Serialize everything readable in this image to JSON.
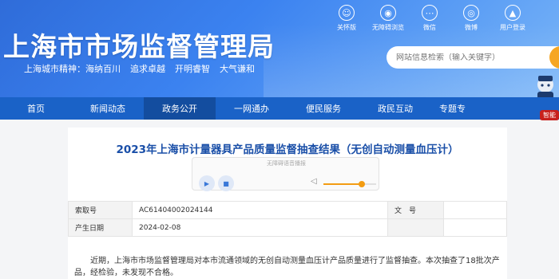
{
  "header": {
    "title": "上海市市场监督管理局",
    "spirit_label": "上海城市精神：",
    "spirit_items": [
      "海纳百川",
      "追求卓越",
      "开明睿智",
      "大气谦和"
    ],
    "tools": [
      {
        "label": "关怀版",
        "icon": "elder-care-icon"
      },
      {
        "label": "无障碍浏览",
        "icon": "eye-icon"
      },
      {
        "label": "微信",
        "icon": "wechat-icon"
      },
      {
        "label": "微博",
        "icon": "weibo-icon"
      },
      {
        "label": "用户登录",
        "icon": "user-icon"
      }
    ],
    "search_placeholder": "网站信息检索（输入关键字）"
  },
  "nav": {
    "items": [
      "首页",
      "新闻动态",
      "政务公开",
      "一网通办",
      "便民服务",
      "政民互动",
      "专题专"
    ],
    "active_index": 2,
    "smart_badge": "智能"
  },
  "article": {
    "title": "2023年上海市计量器具产品质量监督抽查结果（无创自动测量血压计）",
    "player": {
      "title": "无障碍语音播报",
      "volume": 0.72
    },
    "meta": {
      "index_label": "索取号",
      "index_value": "AC61404002024144",
      "doc_label": "文　号",
      "doc_value": "",
      "date_label": "产生日期",
      "date_value": "2024-02-08"
    },
    "body": "近期，上海市市场监督管理局对本市流通领域的无创自动测量血压计产品质量进行了监督抽查。本次抽查了18批次产品，经检验，未发现不合格。"
  },
  "colors": {
    "header_blue": "#3b82f0",
    "nav_blue": "#1a62c7",
    "nav_active": "#134d9f",
    "title_blue": "#1a4fa8",
    "accent_orange": "#f39c12"
  }
}
